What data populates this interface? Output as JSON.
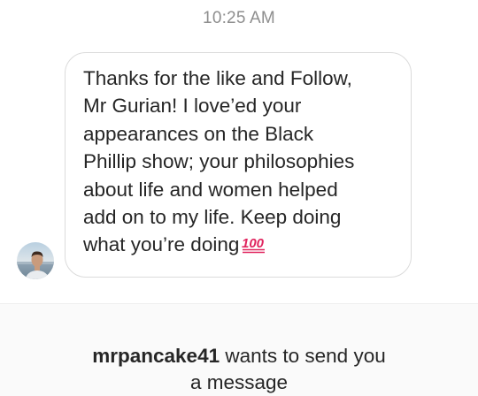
{
  "thread": {
    "timestamp": "10:25 AM"
  },
  "message": {
    "lines": [
      "Thanks for the like and Follow,",
      "Mr Gurian! I love’ed your",
      "appearances on the Black",
      "Phillip show; your philosophies",
      "about life and women helped",
      "add on to my life. Keep doing",
      "what you’re doing"
    ],
    "emoji_icon": "hundred-points-icon",
    "emoji_text": "100",
    "emoji_color": "#e0245e"
  },
  "request": {
    "username": "mrpancake41",
    "text_line1": " wants to send you",
    "text_line2": "a message"
  },
  "colors": {
    "timestamp": "#8e8e8e",
    "bubble_border": "#dbdbdb",
    "panel_background": "#fafafa"
  }
}
